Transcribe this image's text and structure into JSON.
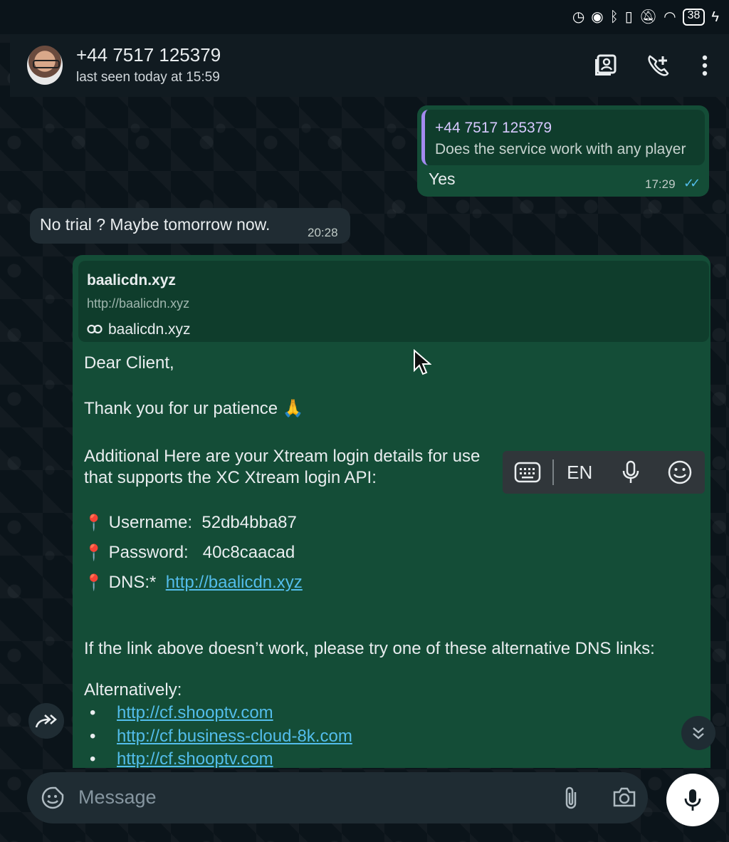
{
  "status_bar": {
    "icons": [
      "speed-icon",
      "eye-icon",
      "bluetooth-icon",
      "vibrate-icon",
      "mute-icon",
      "wifi-icon",
      "battery-icon",
      "charging-icon"
    ],
    "battery": "38"
  },
  "header": {
    "contact_name": "+44 7517 125379",
    "last_seen": "last seen today at 15:59",
    "icons": [
      "contact-card-icon",
      "add-call-icon",
      "more-icon"
    ]
  },
  "messages": {
    "outgoing_reply": {
      "quote_name": "+44 7517 125379",
      "quote_text": "Does the service work with any player",
      "text": "Yes",
      "time": "17:29"
    },
    "incoming": {
      "text": "No trial ? Maybe tomorrow now.",
      "time": "20:28"
    },
    "outgoing_long": {
      "link_preview": {
        "title": "baalicdn.xyz",
        "url": "http://baalicdn.xyz",
        "domain": "baalicdn.xyz"
      },
      "greeting": "Dear Client,",
      "thanks": "Thank you for ur patience 🙏",
      "intro_line1": "Additional Here are your Xtream login details for use",
      "intro_line2": "that supports the XC Xtream login API:",
      "username_label": "Username:",
      "username": "52db4bba87",
      "password_label": "Password:",
      "password": "40c8caacad",
      "dns_label": "DNS:*",
      "dns_link": "http://baalicdn.xyz",
      "alt_intro": "If the link above doesn’t work, please try one of these alternative DNS links:",
      "alternatively": "Alternatively:",
      "alt_links": [
        "http://cf.shooptv.com",
        "http://cf.business-cloud-8k.com",
        "http://cf.shooptv.com"
      ]
    }
  },
  "keyboard_toolbar": {
    "language": "EN",
    "icons": [
      "keyboard-icon",
      "microphone-icon",
      "emoji-icon"
    ]
  },
  "composer": {
    "placeholder": "Message",
    "icons": [
      "sticker-icon",
      "attach-icon",
      "camera-icon",
      "mic-icon"
    ]
  },
  "colors": {
    "background": "#0b141a",
    "outgoing_bubble": "#144d37",
    "incoming_bubble": "#202c33",
    "link": "#53bdeb",
    "quote_accent": "#a48af0"
  }
}
